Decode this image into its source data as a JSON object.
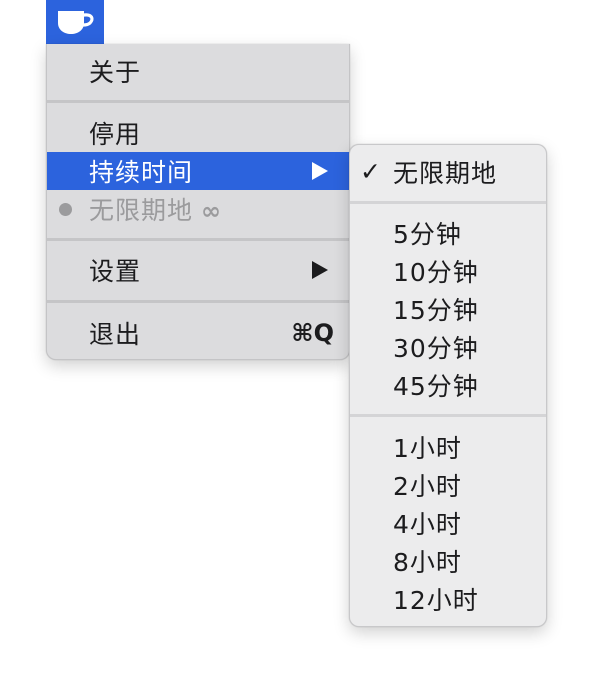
{
  "status_item": {
    "icon": "coffee-cup-icon",
    "accent": "#2c63dd"
  },
  "menu": {
    "about": "关于",
    "disable": "停用",
    "duration": "持续时间",
    "status_label": "无限期地",
    "status_symbol": "∞",
    "settings": "设置",
    "quit": "退出",
    "quit_shortcut": "⌘Q"
  },
  "submenu": {
    "checkmark": "✓",
    "items": [
      "无限期地",
      "5分钟",
      "10分钟",
      "15分钟",
      "30分钟",
      "45分钟",
      "1小时",
      "2小时",
      "4小时",
      "8小时",
      "12小时"
    ]
  }
}
